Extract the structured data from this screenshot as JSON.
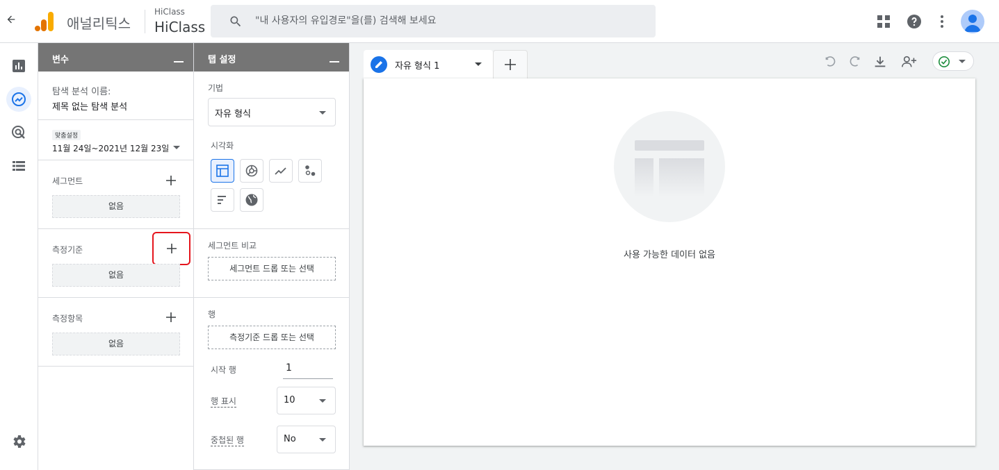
{
  "header": {
    "app_name": "애널리틱스",
    "account_small": "HiClass",
    "account_big": "HiClass",
    "search_placeholder": "\"내 사용자의 유입경로\"을(를) 검색해 보세요"
  },
  "variables_panel": {
    "title": "변수",
    "exploration_label": "탐색 분석 이름:",
    "exploration_name": "제목 없는 탐색 분석",
    "date_badge": "맞춤설정",
    "date_range": "11월 24일~2021년 12월 23일",
    "segments_label": "세그먼트",
    "segments_empty": "없음",
    "dimensions_label": "측정기준",
    "dimensions_empty": "없음",
    "metrics_label": "측정항목",
    "metrics_empty": "없음"
  },
  "tab_settings": {
    "title": "탭 설정",
    "technique_label": "기법",
    "technique_value": "자유 형식",
    "visualization_label": "시각화",
    "segment_compare_label": "세그먼트 비교",
    "segment_drop": "세그먼트 드롭 또는 선택",
    "rows_label": "행",
    "rows_drop": "측정기준 드롭 또는 선택",
    "start_row_label": "시작 행",
    "start_row_value": "1",
    "show_rows_label": "행 표시",
    "show_rows_value": "10",
    "nested_rows_label": "중첩된 행",
    "nested_rows_value": "No"
  },
  "canvas": {
    "tab_label": "자유 형식 1",
    "empty_message": "사용 가능한 데이터 없음"
  },
  "colors": {
    "accent": "#1a73e8",
    "panel_header": "#757575",
    "highlight": "#e5151d",
    "status_ok": "#1e8e3e"
  }
}
